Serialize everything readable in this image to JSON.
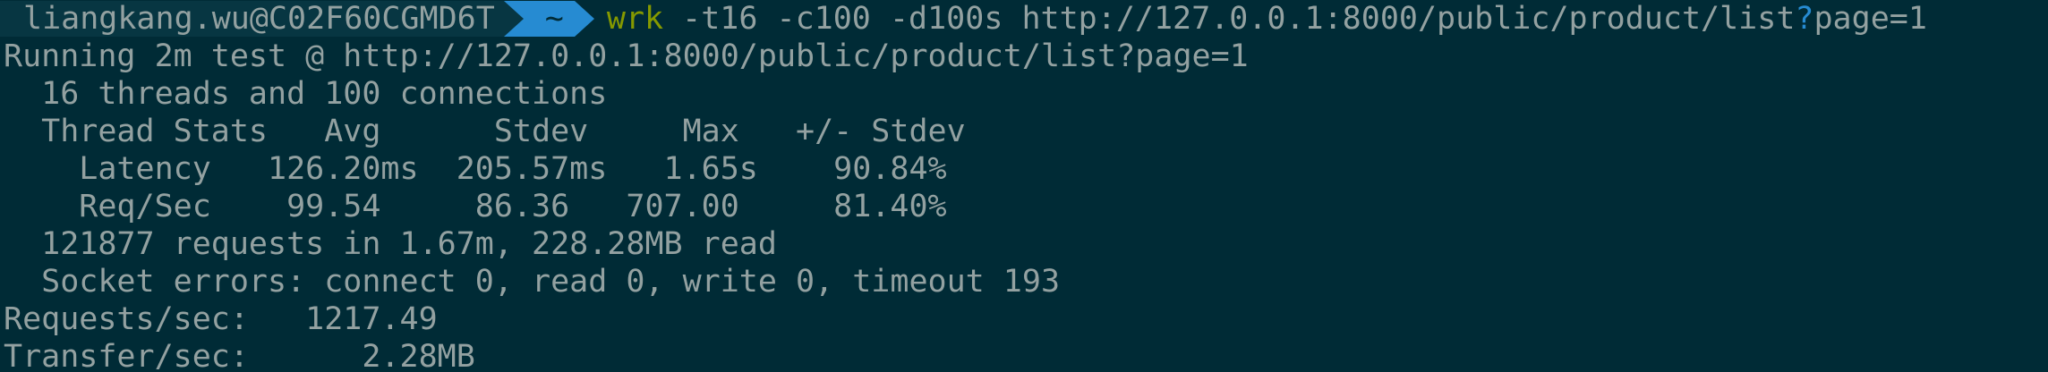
{
  "prompt": {
    "user_host": "liangkang.wu@C02F60CGMD6T",
    "directory": "~",
    "command_name": "wrk",
    "command_args_before_q": " -t16 -c100 -d100s http://127.0.0.1:8000/public/product/list",
    "command_q": "?",
    "command_args_after_q": "page=1"
  },
  "output": {
    "running": "Running 2m test @ http://127.0.0.1:8000/public/product/list?page=1",
    "threads": "  16 threads and 100 connections",
    "stats_header": "  Thread Stats   Avg      Stdev     Max   +/- Stdev",
    "latency": "    Latency   126.20ms  205.57ms   1.65s    90.84%",
    "reqsec": "    Req/Sec    99.54     86.36   707.00     81.40%",
    "requests": "  121877 requests in 1.67m, 228.28MB read",
    "socket_errors": "  Socket errors: connect 0, read 0, write 0, timeout 193",
    "requests_per_sec": "Requests/sec:   1217.49",
    "transfer_per_sec": "Transfer/sec:      2.28MB"
  },
  "colors": {
    "background": "#002b36",
    "foreground": "#93a1a1",
    "segment_user_bg": "#073642",
    "segment_dir_bg": "#268bd2",
    "command_green": "#859900",
    "accent_blue": "#268bd2"
  },
  "icons": {
    "powerline_separator": "powerline-arrow-icon"
  }
}
